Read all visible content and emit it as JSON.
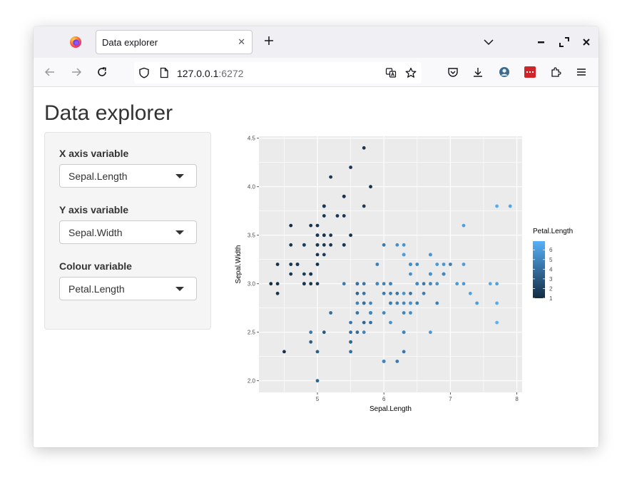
{
  "browser": {
    "tab_title": "Data explorer",
    "url_host": "127.0.0.1",
    "url_port": ":6272"
  },
  "page": {
    "title": "Data explorer"
  },
  "controls": [
    {
      "label": "X axis variable",
      "value": "Sepal.Length"
    },
    {
      "label": "Y axis variable",
      "value": "Sepal.Width"
    },
    {
      "label": "Colour variable",
      "value": "Petal.Length"
    }
  ],
  "colors": {
    "low": "#132B43",
    "high": "#56B1F7",
    "panel_bg": "#EBEBEB",
    "grid": "#FFFFFF"
  },
  "chart_data": {
    "type": "scatter",
    "xlabel": "Sepal.Length",
    "ylabel": "Sepal.Width",
    "xlim": [
      4.3,
      7.9
    ],
    "ylim": [
      2.0,
      4.4
    ],
    "x_ticks": [
      "5",
      "6",
      "7",
      "8"
    ],
    "y_ticks": [
      "2.0",
      "2.5",
      "3.0",
      "3.5",
      "4.0",
      "4.5"
    ],
    "grid": true,
    "legend": {
      "title": "Petal.Length",
      "position": "right",
      "ticks": [
        "1",
        "2",
        "3",
        "4",
        "5",
        "6"
      ],
      "range": [
        1.0,
        6.9
      ]
    },
    "points": [
      [
        5.1,
        3.5,
        1.4
      ],
      [
        4.9,
        3.0,
        1.4
      ],
      [
        4.7,
        3.2,
        1.3
      ],
      [
        4.6,
        3.1,
        1.5
      ],
      [
        5.0,
        3.6,
        1.4
      ],
      [
        5.4,
        3.9,
        1.7
      ],
      [
        4.6,
        3.4,
        1.4
      ],
      [
        5.0,
        3.4,
        1.5
      ],
      [
        4.4,
        2.9,
        1.4
      ],
      [
        4.9,
        3.1,
        1.5
      ],
      [
        5.4,
        3.7,
        1.5
      ],
      [
        4.8,
        3.4,
        1.6
      ],
      [
        4.8,
        3.0,
        1.4
      ],
      [
        4.3,
        3.0,
        1.1
      ],
      [
        5.8,
        4.0,
        1.2
      ],
      [
        5.7,
        4.4,
        1.5
      ],
      [
        5.4,
        3.9,
        1.3
      ],
      [
        5.1,
        3.5,
        1.4
      ],
      [
        5.7,
        3.8,
        1.7
      ],
      [
        5.1,
        3.8,
        1.5
      ],
      [
        5.4,
        3.4,
        1.7
      ],
      [
        5.1,
        3.7,
        1.5
      ],
      [
        4.6,
        3.6,
        1.0
      ],
      [
        5.1,
        3.3,
        1.7
      ],
      [
        4.8,
        3.4,
        1.9
      ],
      [
        5.0,
        3.0,
        1.6
      ],
      [
        5.0,
        3.4,
        1.6
      ],
      [
        5.2,
        3.5,
        1.5
      ],
      [
        5.2,
        3.4,
        1.4
      ],
      [
        4.7,
        3.2,
        1.6
      ],
      [
        4.8,
        3.1,
        1.6
      ],
      [
        5.4,
        3.4,
        1.5
      ],
      [
        5.2,
        4.1,
        1.5
      ],
      [
        5.5,
        4.2,
        1.4
      ],
      [
        4.9,
        3.1,
        1.5
      ],
      [
        5.0,
        3.2,
        1.2
      ],
      [
        5.5,
        3.5,
        1.3
      ],
      [
        4.9,
        3.6,
        1.4
      ],
      [
        4.4,
        3.0,
        1.3
      ],
      [
        5.1,
        3.4,
        1.5
      ],
      [
        5.0,
        3.5,
        1.3
      ],
      [
        4.5,
        2.3,
        1.3
      ],
      [
        4.4,
        3.2,
        1.3
      ],
      [
        5.0,
        3.5,
        1.6
      ],
      [
        5.1,
        3.8,
        1.9
      ],
      [
        4.8,
        3.0,
        1.4
      ],
      [
        5.1,
        3.8,
        1.6
      ],
      [
        4.6,
        3.2,
        1.4
      ],
      [
        5.3,
        3.7,
        1.5
      ],
      [
        5.0,
        3.3,
        1.4
      ],
      [
        7.0,
        3.2,
        4.7
      ],
      [
        6.4,
        3.2,
        4.5
      ],
      [
        6.9,
        3.1,
        4.9
      ],
      [
        5.5,
        2.3,
        4.0
      ],
      [
        6.5,
        2.8,
        4.6
      ],
      [
        5.7,
        2.8,
        4.5
      ],
      [
        6.3,
        3.3,
        4.7
      ],
      [
        4.9,
        2.4,
        3.3
      ],
      [
        6.6,
        2.9,
        4.6
      ],
      [
        5.2,
        2.7,
        3.9
      ],
      [
        5.0,
        2.0,
        3.5
      ],
      [
        5.9,
        3.0,
        4.2
      ],
      [
        6.0,
        2.2,
        4.0
      ],
      [
        6.1,
        2.9,
        4.7
      ],
      [
        5.6,
        2.9,
        3.6
      ],
      [
        6.7,
        3.1,
        4.4
      ],
      [
        5.6,
        3.0,
        4.5
      ],
      [
        5.8,
        2.7,
        4.1
      ],
      [
        6.2,
        2.2,
        4.5
      ],
      [
        5.6,
        2.5,
        3.9
      ],
      [
        5.9,
        3.2,
        4.8
      ],
      [
        6.1,
        2.8,
        4.0
      ],
      [
        6.3,
        2.5,
        4.9
      ],
      [
        6.1,
        2.8,
        4.7
      ],
      [
        6.4,
        2.9,
        4.3
      ],
      [
        6.6,
        3.0,
        4.4
      ],
      [
        6.8,
        2.8,
        4.8
      ],
      [
        6.7,
        3.0,
        5.0
      ],
      [
        6.0,
        2.9,
        4.5
      ],
      [
        5.7,
        2.6,
        3.5
      ],
      [
        5.5,
        2.4,
        3.8
      ],
      [
        5.5,
        2.4,
        3.7
      ],
      [
        5.8,
        2.7,
        3.9
      ],
      [
        6.0,
        2.7,
        5.1
      ],
      [
        5.4,
        3.0,
        4.5
      ],
      [
        6.0,
        3.4,
        4.5
      ],
      [
        6.7,
        3.1,
        4.7
      ],
      [
        6.3,
        2.3,
        4.4
      ],
      [
        5.6,
        3.0,
        4.1
      ],
      [
        5.5,
        2.5,
        4.0
      ],
      [
        5.5,
        2.6,
        4.4
      ],
      [
        6.1,
        3.0,
        4.6
      ],
      [
        5.8,
        2.6,
        4.0
      ],
      [
        5.0,
        2.3,
        3.3
      ],
      [
        5.6,
        2.7,
        4.2
      ],
      [
        5.7,
        3.0,
        4.2
      ],
      [
        5.7,
        2.9,
        4.2
      ],
      [
        6.2,
        2.9,
        4.3
      ],
      [
        5.1,
        2.5,
        3.0
      ],
      [
        5.7,
        2.8,
        4.1
      ],
      [
        6.3,
        3.3,
        6.0
      ],
      [
        5.8,
        2.7,
        5.1
      ],
      [
        7.1,
        3.0,
        5.9
      ],
      [
        6.3,
        2.9,
        5.6
      ],
      [
        6.5,
        3.0,
        5.8
      ],
      [
        7.6,
        3.0,
        6.6
      ],
      [
        4.9,
        2.5,
        4.5
      ],
      [
        7.3,
        2.9,
        6.3
      ],
      [
        6.7,
        2.5,
        5.8
      ],
      [
        7.2,
        3.6,
        6.1
      ],
      [
        6.5,
        3.2,
        5.1
      ],
      [
        6.4,
        2.7,
        5.3
      ],
      [
        6.8,
        3.0,
        5.5
      ],
      [
        5.7,
        2.5,
        5.0
      ],
      [
        5.8,
        2.8,
        5.1
      ],
      [
        6.4,
        3.2,
        5.3
      ],
      [
        6.5,
        3.0,
        5.5
      ],
      [
        7.7,
        3.8,
        6.7
      ],
      [
        7.7,
        2.6,
        6.9
      ],
      [
        6.0,
        2.2,
        5.0
      ],
      [
        6.9,
        3.2,
        5.7
      ],
      [
        5.6,
        2.8,
        4.9
      ],
      [
        7.7,
        2.8,
        6.7
      ],
      [
        6.3,
        2.7,
        4.9
      ],
      [
        6.7,
        3.3,
        5.7
      ],
      [
        7.2,
        3.2,
        6.0
      ],
      [
        6.2,
        2.8,
        4.8
      ],
      [
        6.1,
        3.0,
        4.9
      ],
      [
        6.4,
        2.8,
        5.6
      ],
      [
        7.2,
        3.0,
        5.8
      ],
      [
        7.4,
        2.8,
        6.1
      ],
      [
        7.9,
        3.8,
        6.4
      ],
      [
        6.4,
        2.8,
        5.6
      ],
      [
        6.3,
        2.8,
        5.1
      ],
      [
        6.1,
        2.6,
        5.6
      ],
      [
        7.7,
        3.0,
        6.1
      ],
      [
        6.3,
        3.4,
        5.6
      ],
      [
        6.4,
        3.1,
        5.5
      ],
      [
        6.0,
        3.0,
        4.8
      ],
      [
        6.9,
        3.1,
        5.4
      ],
      [
        6.7,
        3.1,
        5.6
      ],
      [
        6.9,
        3.1,
        5.1
      ],
      [
        5.8,
        2.7,
        5.1
      ],
      [
        6.8,
        3.2,
        5.9
      ],
      [
        6.7,
        3.3,
        5.7
      ],
      [
        6.7,
        3.0,
        5.2
      ],
      [
        6.3,
        2.5,
        5.0
      ],
      [
        6.5,
        3.0,
        5.2
      ],
      [
        6.2,
        3.4,
        5.4
      ],
      [
        5.9,
        3.0,
        5.1
      ]
    ]
  }
}
